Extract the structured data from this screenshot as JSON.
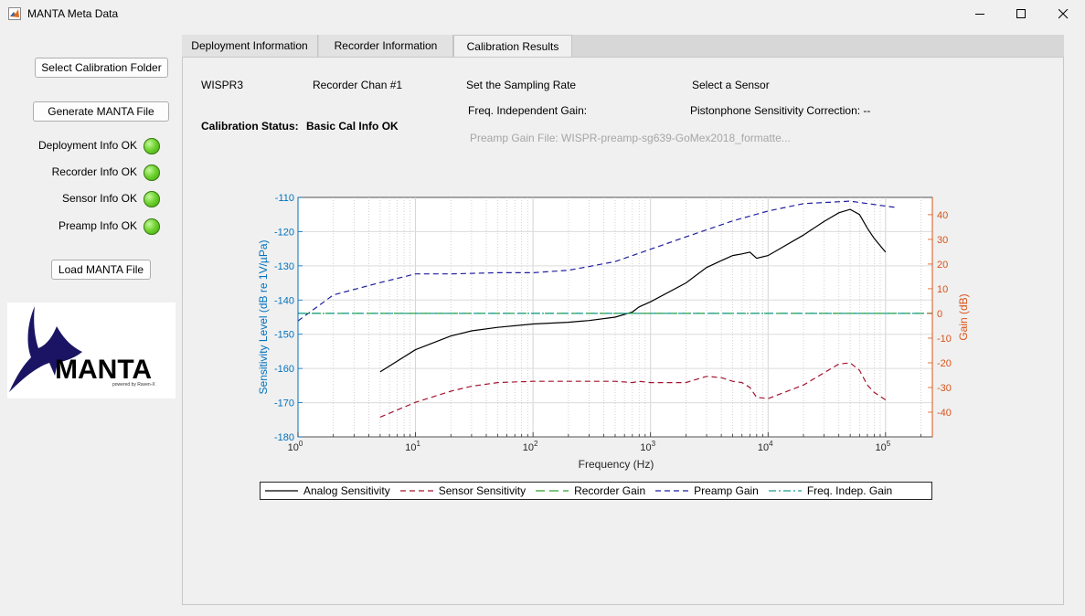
{
  "window": {
    "title": "MANTA Meta Data"
  },
  "sidebar": {
    "select_folder": "Select Calibration Folder",
    "generate": "Generate MANTA File",
    "load": "Load MANTA File",
    "statuses": [
      {
        "label": "Deployment Info OK",
        "color": "#5cc21d"
      },
      {
        "label": "Recorder Info OK",
        "color": "#5cc21d"
      },
      {
        "label": "Sensor Info OK",
        "color": "#5cc21d"
      },
      {
        "label": "Preamp Info OK",
        "color": "#5cc21d"
      }
    ],
    "logo_text": "MANTA",
    "logo_sub": "powered by Raven-X"
  },
  "tabs": [
    {
      "label": "Deployment Information",
      "active": false
    },
    {
      "label": "Recorder Information",
      "active": false
    },
    {
      "label": "Calibration Results",
      "active": true
    }
  ],
  "cal": {
    "recorder": "WISPR3",
    "channel": "Recorder Chan #1",
    "sampling": "Set the Sampling Rate",
    "sensor": "Select a Sensor",
    "status_label": "Calibration Status:",
    "status_value": "Basic Cal Info OK",
    "freq_gain": "Freq. Independent Gain:",
    "pistonphone": "Pistonphone Sensitivity Correction: --",
    "preamp_file": "Preamp Gain File: WISPR-preamp-sg639-GoMex2018_formatte..."
  },
  "chart_data": {
    "type": "line",
    "xlabel": "Frequency (Hz)",
    "ylabel": "Sensitivity Level (dB re 1V/µPa)",
    "y2label": "Gain (dB)",
    "xscale": "log",
    "xlim": [
      1,
      250000
    ],
    "ylim": [
      -180,
      -110
    ],
    "y2lim": [
      -50,
      47
    ],
    "xticks": [
      {
        "base": "10",
        "exp": "0"
      },
      {
        "base": "10",
        "exp": "1"
      },
      {
        "base": "10",
        "exp": "2"
      },
      {
        "base": "10",
        "exp": "3"
      },
      {
        "base": "10",
        "exp": "4"
      },
      {
        "base": "10",
        "exp": "5"
      }
    ],
    "yticks": [
      "-110",
      "-120",
      "-130",
      "-140",
      "-150",
      "-160",
      "-170",
      "-180"
    ],
    "y2ticks": [
      "40",
      "30",
      "20",
      "10",
      "0",
      "-10",
      "-20",
      "-30",
      "-40"
    ],
    "grid": true,
    "colors": {
      "left_axis": "#0072bd",
      "right_axis": "#d95319"
    },
    "series": [
      {
        "name": "Analog Sensitivity",
        "axis": "left",
        "color": "#000000",
        "dash": "",
        "x": [
          5,
          10,
          20,
          30,
          50,
          100,
          200,
          300,
          500,
          700,
          800,
          1000,
          2000,
          3000,
          4000,
          5000,
          6000,
          7000,
          8000,
          10000,
          20000,
          30000,
          40000,
          50000,
          60000,
          70000,
          80000,
          100000
        ],
        "y": [
          -161,
          -154.5,
          -150.5,
          -149,
          -148,
          -147,
          -146.5,
          -146,
          -145,
          -143.5,
          -142,
          -140.5,
          -135,
          -130.5,
          -128.5,
          -127,
          -126.5,
          -126,
          -127.8,
          -127,
          -121,
          -117,
          -114.5,
          -113.5,
          -115,
          -119,
          -122,
          -126
        ]
      },
      {
        "name": "Sensor Sensitivity",
        "axis": "right",
        "color": "#a2142f",
        "dash": "6,4",
        "x": [
          5,
          10,
          20,
          30,
          50,
          100,
          200,
          300,
          500,
          700,
          800,
          1000,
          2000,
          3000,
          4000,
          5000,
          6000,
          7000,
          8000,
          10000,
          20000,
          30000,
          40000,
          50000,
          60000,
          70000,
          80000,
          100000
        ],
        "y": [
          -42,
          -36,
          -31.5,
          -29.5,
          -28,
          -27.5,
          -27.5,
          -27.5,
          -27.5,
          -28,
          -27.5,
          -28,
          -28,
          -25.5,
          -26,
          -27.5,
          -28,
          -30,
          -34,
          -34.5,
          -29,
          -24,
          -20.5,
          -20,
          -23,
          -29,
          -32,
          -35
        ]
      },
      {
        "name": "Recorder Gain",
        "axis": "right",
        "color": "#2ca02c",
        "dash": "10,5",
        "x": [
          1,
          250000
        ],
        "y": [
          0,
          0
        ]
      },
      {
        "name": "Preamp Gain",
        "axis": "right",
        "color": "#1f1f9f",
        "dash": "6,4",
        "x": [
          1,
          2,
          5,
          10,
          20,
          50,
          100,
          200,
          300,
          500,
          1000,
          2000,
          5000,
          10000,
          20000,
          50000,
          100000,
          120000
        ],
        "y": [
          -3,
          7.5,
          12.5,
          16,
          16,
          16.5,
          16.5,
          17.5,
          19,
          21,
          26,
          31,
          37.5,
          41.5,
          44.5,
          45.5,
          43.5,
          43
        ]
      },
      {
        "name": "Freq. Indep. Gain",
        "axis": "right",
        "color": "#1a9e8f",
        "dash": "8,3,2,3",
        "x": [
          1,
          250000
        ],
        "y": [
          0,
          0
        ]
      }
    ]
  }
}
